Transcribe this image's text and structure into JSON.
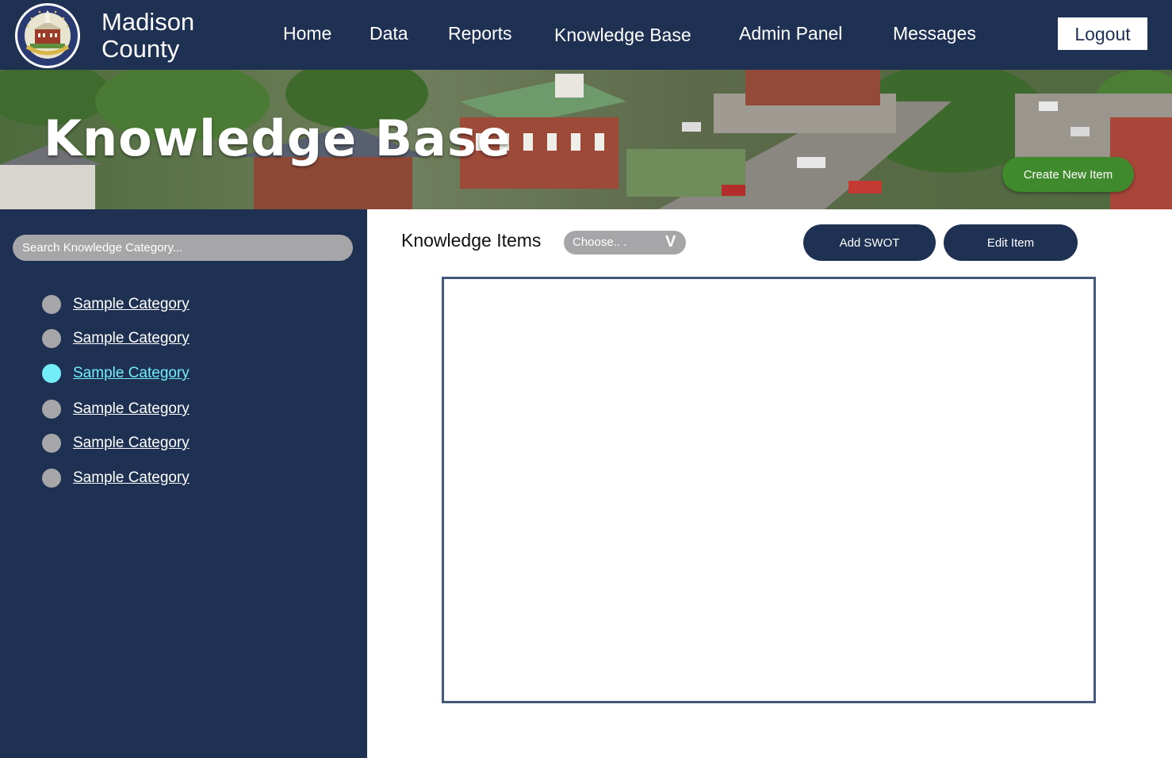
{
  "header": {
    "brand_line1": "Madison",
    "brand_line2": "County",
    "seal_text": "Madison County",
    "seal_year": "1792",
    "nav": [
      {
        "label": "Home"
      },
      {
        "label": "Data"
      },
      {
        "label": "Reports"
      },
      {
        "label": "Knowledge Base"
      },
      {
        "label": "Admin Panel"
      },
      {
        "label": "Messages"
      }
    ],
    "logout_label": "Logout"
  },
  "banner": {
    "title": "Knowledge Base",
    "create_label": "Create New Item"
  },
  "sidebar": {
    "search_placeholder": "Search Knowledge Category...",
    "categories": [
      {
        "label": "Sample Category",
        "active": false
      },
      {
        "label": "Sample Category",
        "active": false
      },
      {
        "label": "Sample Category",
        "active": true
      },
      {
        "label": "Sample Category",
        "active": false
      },
      {
        "label": "Sample Category",
        "active": false
      },
      {
        "label": "Sample Category",
        "active": false
      }
    ]
  },
  "main": {
    "title": "Knowledge Items",
    "dropdown_value": "Choose.. .",
    "dropdown_caret": "V",
    "add_swot_label": "Add SWOT",
    "edit_item_label": "Edit Item"
  },
  "colors": {
    "navy": "#1f3153",
    "gray_control": "#a6a6a8",
    "active_cyan": "#72edf7",
    "green_button": "#3f8a2d",
    "box_border": "#44597a"
  }
}
